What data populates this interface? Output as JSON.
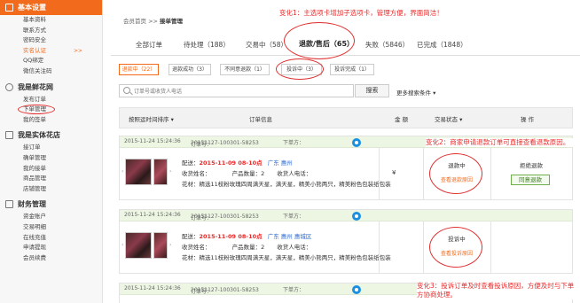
{
  "sidebar": {
    "sections": [
      {
        "title": "基本设置",
        "items": [
          "基本资料",
          "联系方式",
          "密码安全",
          "实名认证",
          "QQ绑定",
          "微信关注码"
        ],
        "active_item": 3,
        "active_arrow": ">>"
      },
      {
        "title": "我是鲜花网",
        "items": [
          "发布订单",
          "下单管理",
          "我的签单"
        ],
        "circled_item": 1
      },
      {
        "title": "我是实体花店",
        "items": [
          "接订单",
          "确单管理",
          "我的接单",
          "商品管理",
          "店铺管理"
        ]
      },
      {
        "title": "财务管理",
        "items": [
          "资金账户",
          "交易明细",
          "在线充值",
          "申请提现",
          "会员续费"
        ]
      }
    ]
  },
  "breadcrumb": {
    "home": "会员首页",
    "sep": " >> ",
    "current": "接单管理"
  },
  "notes": {
    "n1": "变化1：主选项卡增加子选项卡，管理方便，界面简洁！",
    "n2": "变化2：商家申请退款订单可直接查看退款原因。",
    "n3": "变化3：投诉订单及时查看投诉原因，方便及时与下单方协商处理。"
  },
  "tabs": [
    "全部订单",
    "待处理（188）",
    "交易中（58）",
    "退款/售后（65）",
    "失败（5846）",
    "已完成（1848）"
  ],
  "active_tab": 3,
  "subtabs": [
    "退款中（22）",
    "退款成功（3）",
    "不同意退款（1）",
    "投诉中（3）",
    "投诉完成（1）"
  ],
  "search": {
    "placeholder": "订单号或收货人电话",
    "button": "搜索",
    "more": "更多搜索条件 ▾"
  },
  "table_head": {
    "sort": "按照运时间排序 ▾",
    "info": "订单信息",
    "amount": "金 额",
    "status": "交易状态 ▾",
    "ops": "操 作"
  },
  "orders": [
    {
      "time": "2015-11-24 15:24:36",
      "order_no_label": "订单号：",
      "order_no": "20151127-100301-58253",
      "buyer_label": "下单方：",
      "delivery_label": "配送：",
      "delivery_time": "2015-11-09 08-10点",
      "city": "广东 惠州",
      "recipient_label": "收货姓名：",
      "recipient": "",
      "qty_label": "产品数量：",
      "qty": "2",
      "phone_label": "收货人电话：",
      "phone": "",
      "flowers": "花材：精选11枝粉玫瑰四周满天星，满天星，精美小熊两只，精美粉色包装纸包装",
      "amount": "¥",
      "status": "退款中",
      "status_link": "查看退款原因",
      "op_text": "拒绝退款",
      "op_button": "同意退款"
    },
    {
      "time": "2015-11-24 15:24:36",
      "order_no_label": "订单号：",
      "order_no": "20151127-100301-58253",
      "buyer_label": "下单方：",
      "delivery_label": "配送：",
      "delivery_time": "2015-11-09 08-10点",
      "city": "广东 惠州 惠城区",
      "recipient_label": "收货姓名：",
      "recipient": "",
      "qty_label": "产品数量：",
      "qty": "2",
      "phone_label": "收货人电话：",
      "phone": "",
      "flowers": "花材：精选11枝粉玫瑰四周满天星，满天星，精美小熊两只，精美粉色包装纸包装",
      "status": "投诉中",
      "status_link": "查看投诉原因"
    },
    {
      "time": "2015-11-24 15:24:36",
      "order_no_label": "订单号：",
      "order_no": "20151127-100301-58253",
      "buyer_label": "下单方："
    }
  ],
  "colors": {
    "accent": "#f26a1b",
    "note": "#e82a2a",
    "annotation_circle": "#e03030"
  }
}
